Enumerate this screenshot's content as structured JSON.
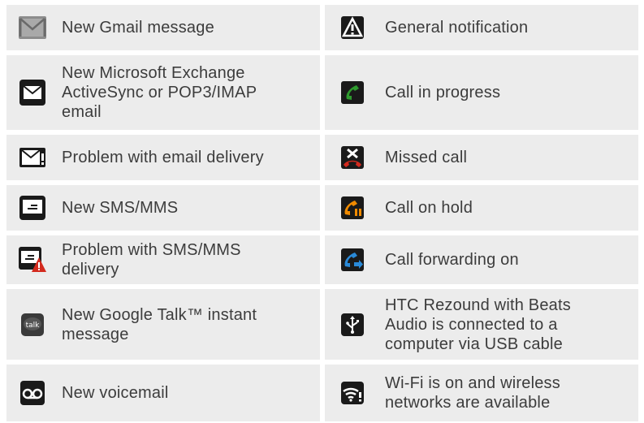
{
  "left": [
    {
      "icon": "gmail-icon",
      "label": "New Gmail message"
    },
    {
      "icon": "email-icon",
      "label": "New Microsoft Exchange ActiveSync or POP3/IMAP email"
    },
    {
      "icon": "email-error-icon",
      "label": "Problem with email delivery"
    },
    {
      "icon": "sms-icon",
      "label": "New SMS/MMS"
    },
    {
      "icon": "sms-error-icon",
      "label": "Problem with SMS/MMS delivery"
    },
    {
      "icon": "google-talk-icon",
      "label": "New Google Talk™ instant message"
    },
    {
      "icon": "voicemail-icon",
      "label": "New voicemail"
    }
  ],
  "right": [
    {
      "icon": "general-notification-icon",
      "label": "General notification"
    },
    {
      "icon": "call-in-progress-icon",
      "label": "Call in progress"
    },
    {
      "icon": "missed-call-icon",
      "label": "Missed call"
    },
    {
      "icon": "call-on-hold-icon",
      "label": "Call on hold"
    },
    {
      "icon": "call-forwarding-icon",
      "label": "Call forwarding on"
    },
    {
      "icon": "usb-icon",
      "label": "HTC Rezound with Beats Audio is connected to a computer via USB cable"
    },
    {
      "icon": "wifi-available-icon",
      "label": "Wi-Fi is on and wireless networks are available"
    }
  ],
  "colors": {
    "cell_bg": "#ececec",
    "text": "#3c3c3c",
    "alert_red": "#d32a1e",
    "call_green": "#2e9b2e",
    "call_orange": "#f08a00",
    "call_blue": "#2a8ad8"
  }
}
